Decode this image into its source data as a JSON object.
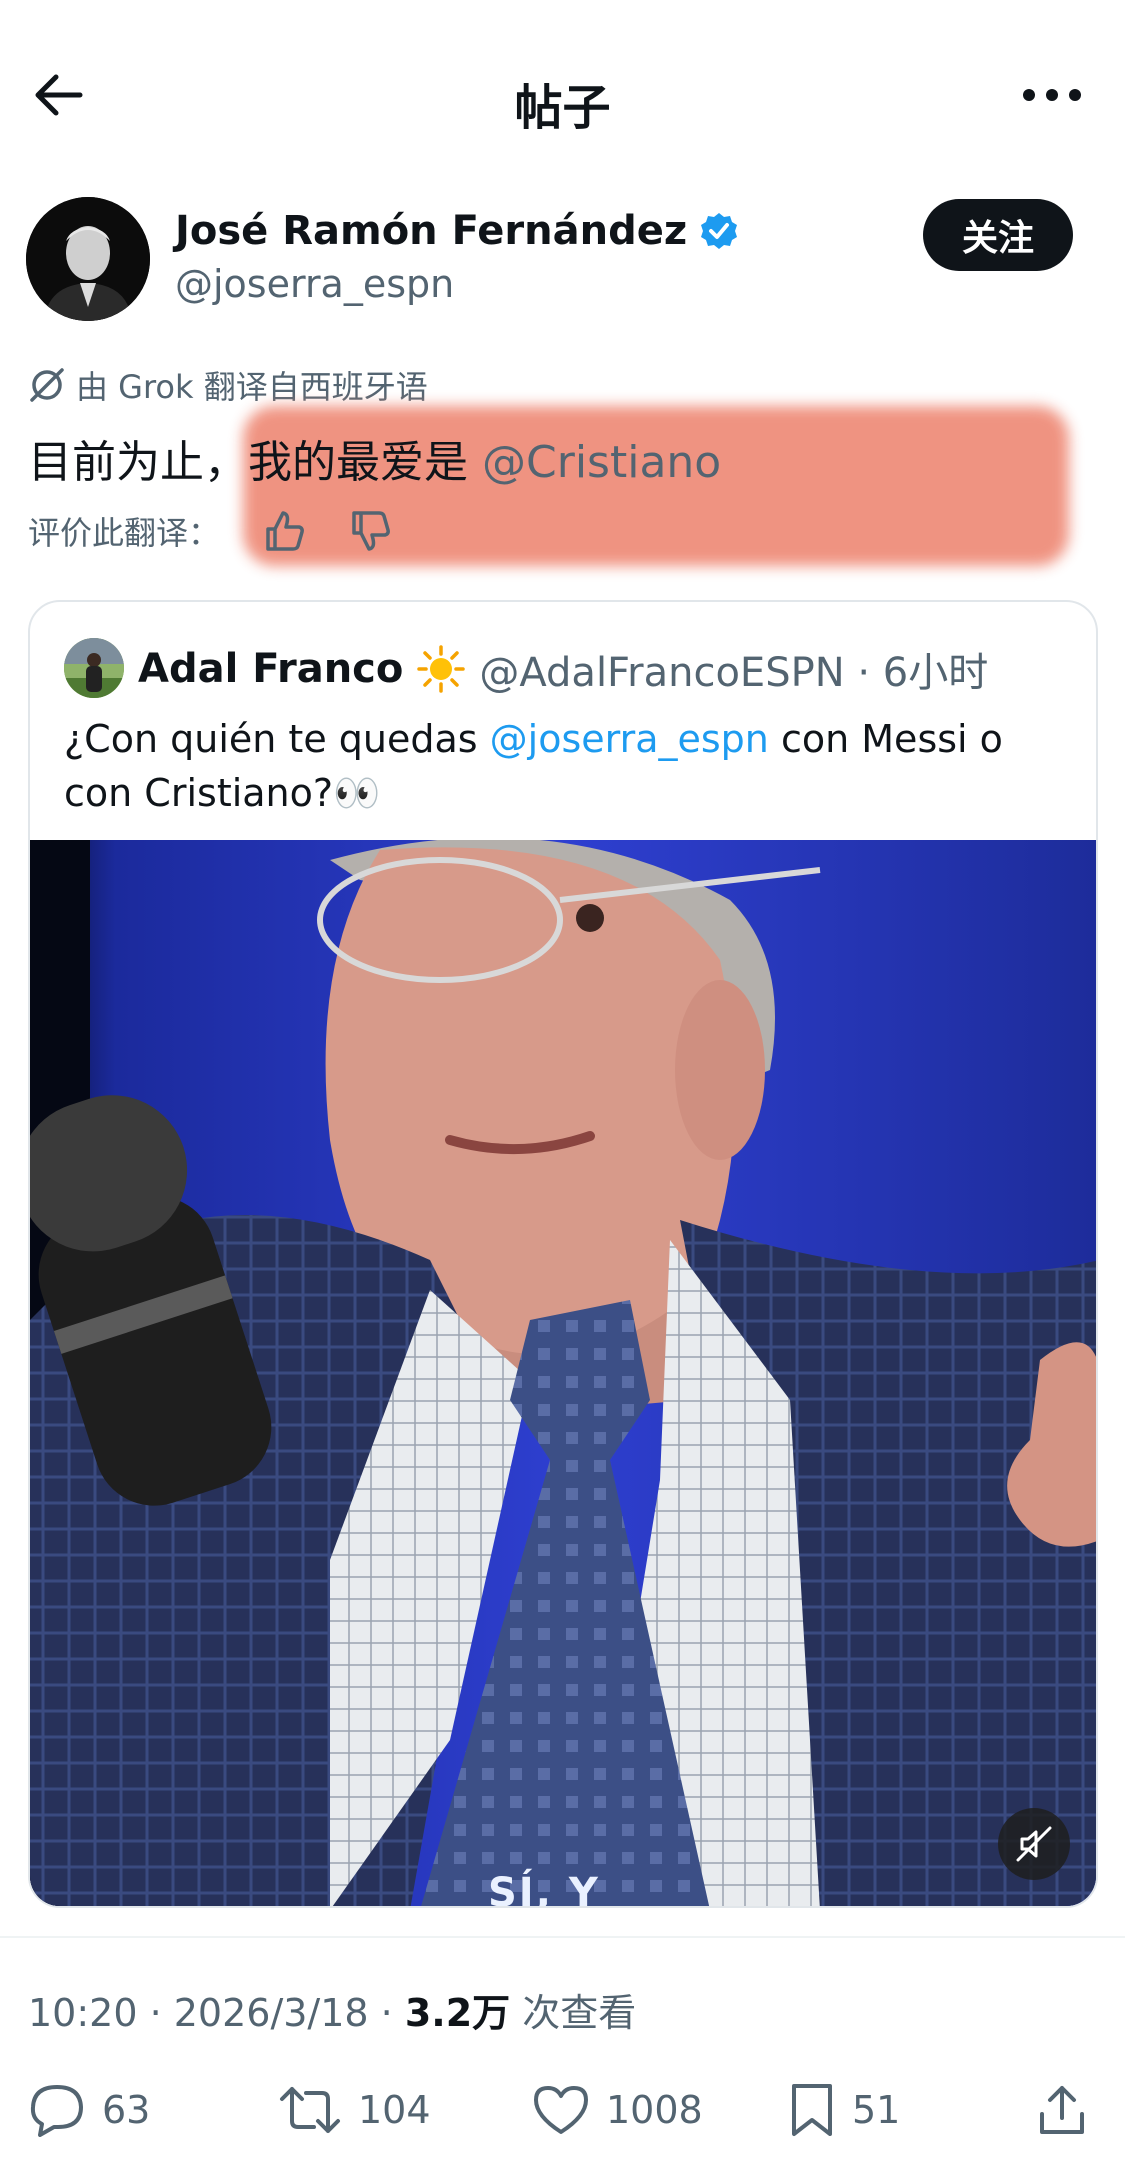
{
  "header": {
    "title": "帖子"
  },
  "author": {
    "name": "José Ramón Fernández",
    "handle": "@joserra_espn",
    "follow_label": "关注"
  },
  "translation": {
    "grok_label": "由 Grok 翻译自西班牙语",
    "text_prefix": "目前为止，",
    "text_main": "我的最爱是 ",
    "mention": "@Cristiano",
    "rate_label": "评价此翻译："
  },
  "quote": {
    "name": "Adal Franco",
    "handle_time": "@AdalFrancoESPN · 6小时",
    "text_part1": "¿Con quién te quedas ",
    "text_mention": "@joserra_espn",
    "text_part2": " con Messi o con Cristiano?👀",
    "video_caption_fragment": "SÍ, Y"
  },
  "meta": {
    "time_date": "10:20 · 2026/3/18 · ",
    "views": "3.2万",
    "views_suffix": " 次查看"
  },
  "actions": {
    "replies": "63",
    "reposts": "104",
    "likes": "1008",
    "bookmarks": "51"
  },
  "colors": {
    "accent": "#1d9bf0",
    "highlight": "#ef8e7b",
    "secondary_text": "#536471"
  }
}
